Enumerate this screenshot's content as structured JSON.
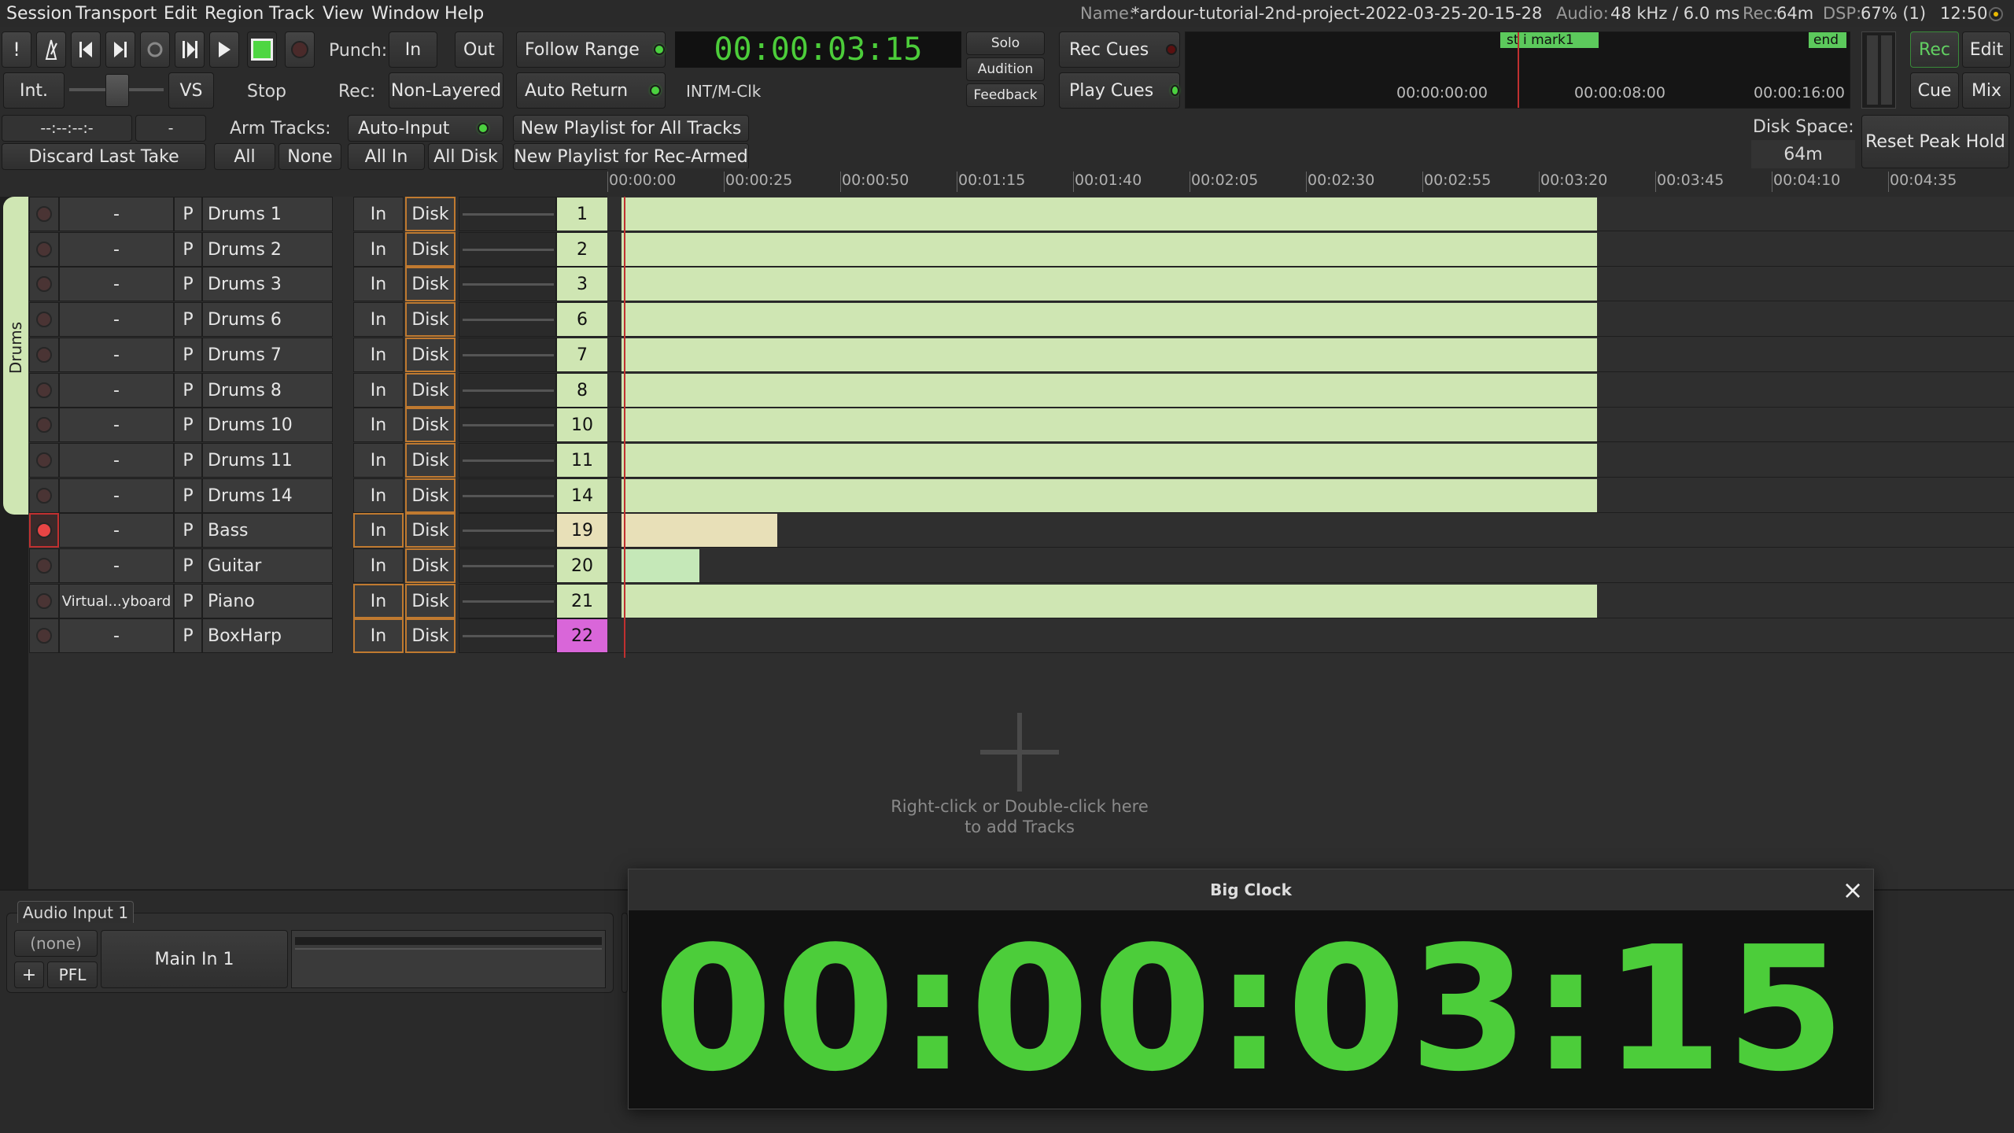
{
  "menu": [
    "Session",
    "Transport",
    "Edit",
    "Region",
    "Track",
    "View",
    "Window",
    "Help"
  ],
  "status": {
    "name_label": "Name:",
    "name_value": "*ardour-tutorial-2nd-project-2022-03-25-20-15-28",
    "audio_label": "Audio:",
    "audio_value": "48 kHz / 6.0 ms",
    "rec_label": "Rec:",
    "rec_value": "64m",
    "dsp_label": "DSP:",
    "dsp_value": "67% (1)",
    "time": "12:50"
  },
  "transport": {
    "punch_label": "Punch:",
    "punch_in": "In",
    "punch_out": "Out",
    "rec_label": "Rec:",
    "rec_mode": "Non-Layered",
    "follow_range": "Follow Range",
    "auto_return": "Auto Return",
    "clock": "00:00:03:15",
    "clock_source": "INT/M-Clk",
    "int_label": "Int.",
    "vs_label": "VS",
    "stop_label": "Stop",
    "solo": "Solo",
    "audition": "Audition",
    "feedback": "Feedback",
    "rec_cues": "Rec Cues",
    "play_cues": "Play Cues"
  },
  "mini_timeline": {
    "markers": [
      "st",
      "i",
      "mark1",
      "end"
    ],
    "times": [
      "00:00:00:00",
      "00:00:08:00",
      "00:00:16:00"
    ]
  },
  "view_buttons": [
    "Rec",
    "Edit",
    "Cue",
    "Mix"
  ],
  "rec_toolbar": {
    "clock_a": "--:--:--:-",
    "clock_b": "-",
    "discard": "Discard Last Take",
    "arm_label": "Arm Tracks:",
    "arm_all": "All",
    "arm_none": "None",
    "auto_input": "Auto-Input",
    "all_in": "All In",
    "all_disk": "All Disk",
    "new_playlist_all": "New Playlist for All Tracks",
    "new_playlist_armed": "New Playlist for Rec-Armed",
    "disk_space_label": "Disk Space:",
    "disk_space_value": "64m",
    "reset_peak": "Reset Peak Hold"
  },
  "ruler": [
    "00:00:00",
    "00:00:25",
    "00:00:50",
    "00:01:15",
    "00:01:40",
    "00:02:05",
    "00:02:30",
    "00:02:55",
    "00:03:20",
    "00:03:45",
    "00:04:10",
    "00:04:35"
  ],
  "group_label": "Drums",
  "tracks": [
    {
      "armed": false,
      "input": "-",
      "p": "P",
      "name": "Drums 1",
      "in": "In",
      "disk": "Disk",
      "num": "1",
      "region_end": 1.0
    },
    {
      "armed": false,
      "input": "-",
      "p": "P",
      "name": "Drums 2",
      "in": "In",
      "disk": "Disk",
      "num": "2",
      "region_end": 1.0
    },
    {
      "armed": false,
      "input": "-",
      "p": "P",
      "name": "Drums 3",
      "in": "In",
      "disk": "Disk",
      "num": "3",
      "region_end": 1.0
    },
    {
      "armed": false,
      "input": "-",
      "p": "P",
      "name": "Drums 6",
      "in": "In",
      "disk": "Disk",
      "num": "6",
      "region_end": 1.0
    },
    {
      "armed": false,
      "input": "-",
      "p": "P",
      "name": "Drums 7",
      "in": "In",
      "disk": "Disk",
      "num": "7",
      "region_end": 1.0
    },
    {
      "armed": false,
      "input": "-",
      "p": "P",
      "name": "Drums 8",
      "in": "In",
      "disk": "Disk",
      "num": "8",
      "region_end": 1.0
    },
    {
      "armed": false,
      "input": "-",
      "p": "P",
      "name": "Drums 10",
      "in": "In",
      "disk": "Disk",
      "num": "10",
      "region_end": 1.0
    },
    {
      "armed": false,
      "input": "-",
      "p": "P",
      "name": "Drums 11",
      "in": "In",
      "disk": "Disk",
      "num": "11",
      "region_end": 1.0
    },
    {
      "armed": false,
      "input": "-",
      "p": "P",
      "name": "Drums 14",
      "in": "In",
      "disk": "Disk",
      "num": "14",
      "region_end": 1.0
    },
    {
      "armed": true,
      "input": "-",
      "p": "P",
      "name": "Bass",
      "in": "In",
      "disk": "Disk",
      "num": "19",
      "region_end": 0.16
    },
    {
      "armed": false,
      "input": "-",
      "p": "P",
      "name": "Guitar",
      "in": "In",
      "disk": "Disk",
      "num": "20",
      "region_end": 0.08
    },
    {
      "armed": false,
      "input": "Virtual...yboard",
      "p": "P",
      "name": "Piano",
      "in": "In",
      "disk": "Disk",
      "num": "21",
      "region_end": 1.0
    },
    {
      "armed": false,
      "input": "-",
      "p": "P",
      "name": "BoxHarp",
      "in": "In",
      "disk": "Disk",
      "num": "22",
      "region_end": 0.0
    }
  ],
  "add_tracks_hint": [
    "Right-click or Double-click here",
    "to add Tracks"
  ],
  "input_strip": {
    "title": "Audio Input 1",
    "none": "(none)",
    "plus": "+",
    "pfl": "PFL",
    "main_in": "Main In 1"
  },
  "big_clock": {
    "title": "Big Clock",
    "close": "×",
    "value": "00:00:03:15"
  },
  "colors": {
    "region_green": "#cfe6b3",
    "region_bass": "#e8e0b8",
    "region_guitar": "#c5e8b8",
    "boxharp_num": "#d966d9",
    "clock_green": "#4ccd3a"
  }
}
